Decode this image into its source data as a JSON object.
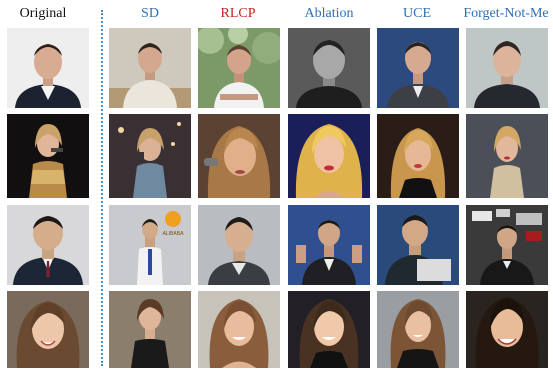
{
  "columns": [
    {
      "key": "original",
      "label": "Original",
      "color": "#111111"
    },
    {
      "key": "sd",
      "label": "SD",
      "color": "#2f6fb4"
    },
    {
      "key": "rlcp",
      "label": "RLCP",
      "color": "#cc1f1f"
    },
    {
      "key": "ablation",
      "label": "Ablation",
      "color": "#2f6fb4"
    },
    {
      "key": "uce",
      "label": "UCE",
      "color": "#2f6fb4"
    },
    {
      "key": "fnm",
      "label": "Forget-Not-Me",
      "color": "#2f6fb4"
    }
  ],
  "figure": {
    "rows": [
      {
        "subject": "man-suit-short-hair"
      },
      {
        "subject": "woman-blonde-sparkly-dress"
      },
      {
        "subject": "man-asian-suit"
      },
      {
        "subject": "woman-brunette-smile"
      }
    ],
    "inset_logo_text": "ALIBABA"
  }
}
